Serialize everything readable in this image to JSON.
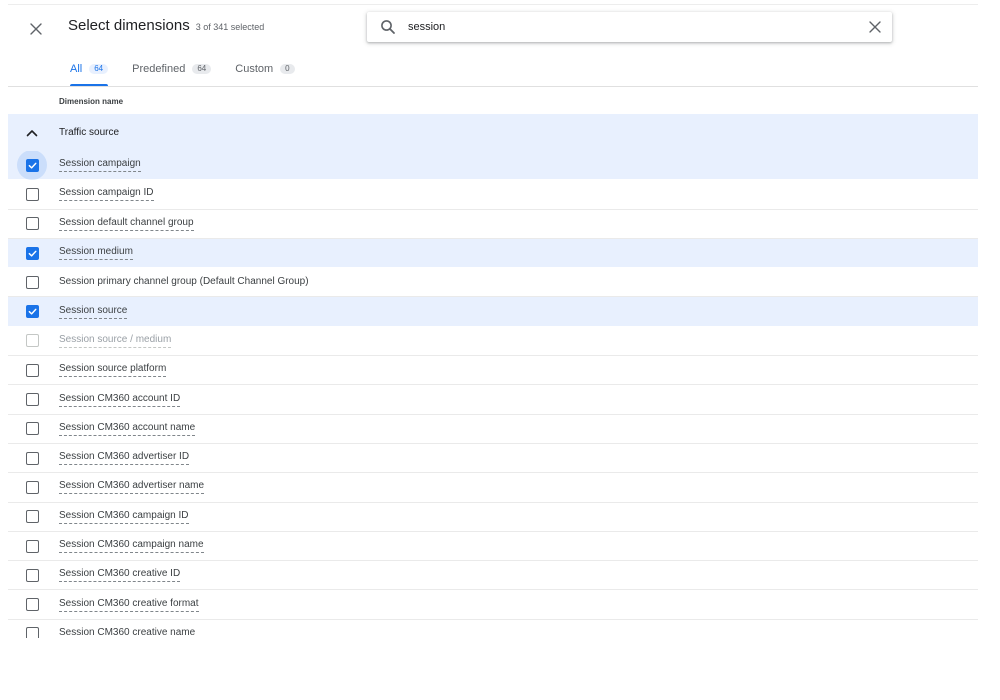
{
  "dialog": {
    "title": "Select dimensions",
    "selected_count": "3 of 341 selected",
    "close_icon": "close-icon"
  },
  "search": {
    "value": "session",
    "placeholder": "Search",
    "search_icon": "search-icon",
    "clear_icon": "clear-icon"
  },
  "tabs": [
    {
      "label": "All",
      "count": "64",
      "active": true
    },
    {
      "label": "Predefined",
      "count": "64",
      "active": false
    },
    {
      "label": "Custom",
      "count": "0",
      "active": false
    }
  ],
  "table": {
    "column_header": "Dimension name",
    "group": {
      "label": "Traffic source",
      "expanded": true,
      "icon": "chevron-up-icon"
    },
    "rows": [
      {
        "label": "Session campaign",
        "checked": true,
        "focused": true,
        "disabled": false,
        "underline": true
      },
      {
        "label": "Session campaign ID",
        "checked": false,
        "focused": false,
        "disabled": false,
        "underline": true
      },
      {
        "label": "Session default channel group",
        "checked": false,
        "focused": false,
        "disabled": false,
        "underline": true
      },
      {
        "label": "Session medium",
        "checked": true,
        "focused": false,
        "disabled": false,
        "underline": true
      },
      {
        "label": "Session primary channel group (Default Channel Group)",
        "checked": false,
        "focused": false,
        "disabled": false,
        "underline": false
      },
      {
        "label": "Session source",
        "checked": true,
        "focused": false,
        "disabled": false,
        "underline": true
      },
      {
        "label": "Session source / medium",
        "checked": false,
        "focused": false,
        "disabled": true,
        "underline": true
      },
      {
        "label": "Session source platform",
        "checked": false,
        "focused": false,
        "disabled": false,
        "underline": true
      },
      {
        "label": "Session CM360 account ID",
        "checked": false,
        "focused": false,
        "disabled": false,
        "underline": true
      },
      {
        "label": "Session CM360 account name",
        "checked": false,
        "focused": false,
        "disabled": false,
        "underline": true
      },
      {
        "label": "Session CM360 advertiser ID",
        "checked": false,
        "focused": false,
        "disabled": false,
        "underline": true
      },
      {
        "label": "Session CM360 advertiser name",
        "checked": false,
        "focused": false,
        "disabled": false,
        "underline": true
      },
      {
        "label": "Session CM360 campaign ID",
        "checked": false,
        "focused": false,
        "disabled": false,
        "underline": true
      },
      {
        "label": "Session CM360 campaign name",
        "checked": false,
        "focused": false,
        "disabled": false,
        "underline": true
      },
      {
        "label": "Session CM360 creative ID",
        "checked": false,
        "focused": false,
        "disabled": false,
        "underline": true
      },
      {
        "label": "Session CM360 creative format",
        "checked": false,
        "focused": false,
        "disabled": false,
        "underline": true
      },
      {
        "label": "Session CM360 creative name",
        "checked": false,
        "focused": false,
        "disabled": false,
        "underline": true
      }
    ]
  },
  "colors": {
    "accent": "#1a73e8",
    "selected_row_bg": "#e8f0fe",
    "text_primary": "#202124",
    "text_secondary": "#5f6368"
  }
}
